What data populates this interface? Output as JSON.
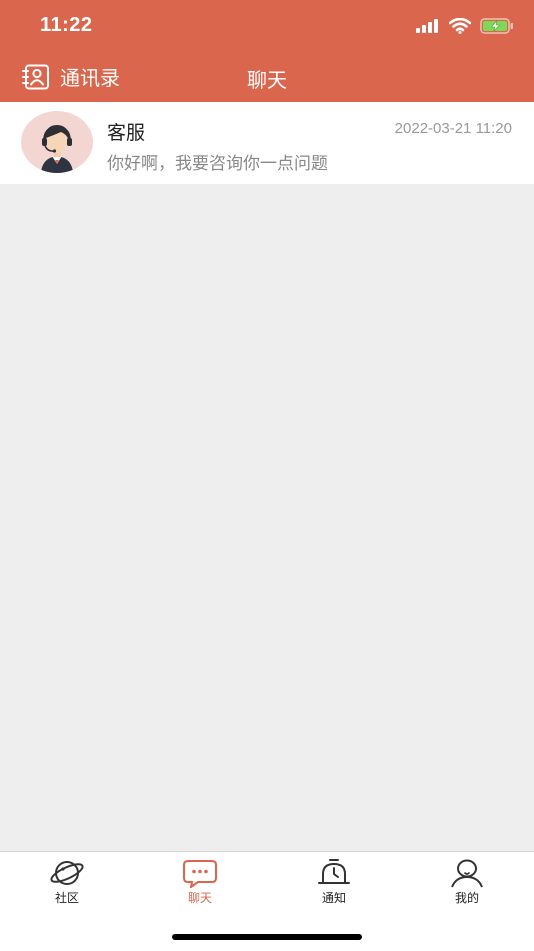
{
  "status_bar": {
    "time": "11:22"
  },
  "header": {
    "contacts_label": "通讯录",
    "title": "聊天"
  },
  "chats": [
    {
      "name": "客服",
      "time": "2022-03-21 11:20",
      "message": "你好啊，我要咨询你一点问题"
    }
  ],
  "tabbar": {
    "tabs": [
      {
        "label": "社区",
        "icon": "planet-icon"
      },
      {
        "label": "聊天",
        "icon": "chat-bubble-icon",
        "active": true
      },
      {
        "label": "通知",
        "icon": "bell-icon"
      },
      {
        "label": "我的",
        "icon": "person-icon"
      }
    ]
  },
  "colors": {
    "accent": "#d9664d",
    "background": "#eeeeee",
    "battery": "#7ed957"
  }
}
